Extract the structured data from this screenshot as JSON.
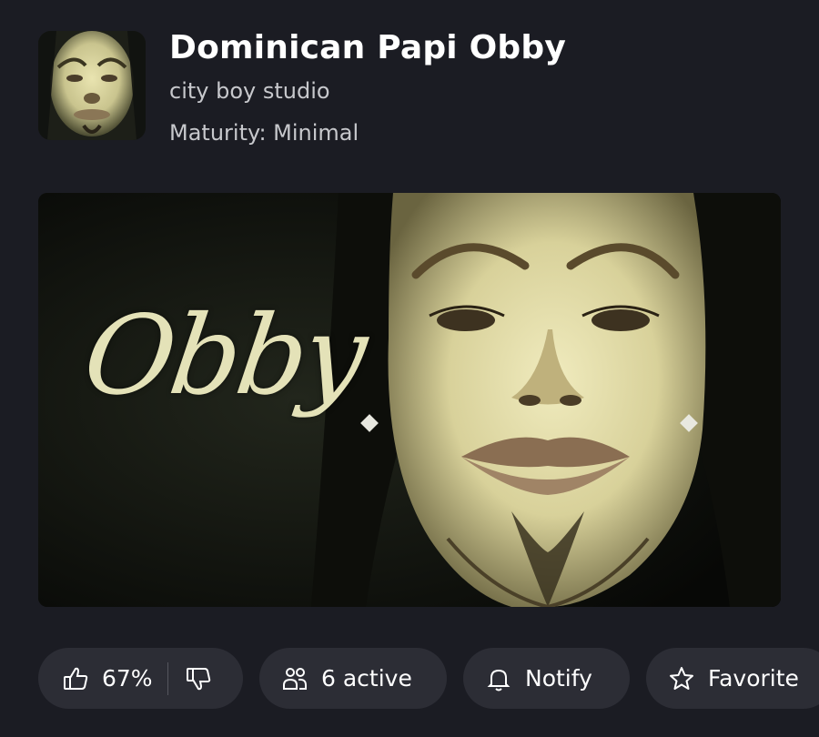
{
  "experience": {
    "title": "Dominican Papi Obby",
    "creator": "city boy studio",
    "maturity": "Maturity: Minimal",
    "thumbnail_icon": "face-thumbnail-image",
    "hero_logo_text": "Obby"
  },
  "actions": {
    "like_percent": "67%",
    "active_label": "6 active",
    "notify_label": "Notify",
    "favorite_label": "Favorite"
  },
  "colors": {
    "background": "#1b1c23",
    "pill": "#2c2d35",
    "secondary_text": "#c7c8cc",
    "logo_text": "#e4e2b8"
  }
}
